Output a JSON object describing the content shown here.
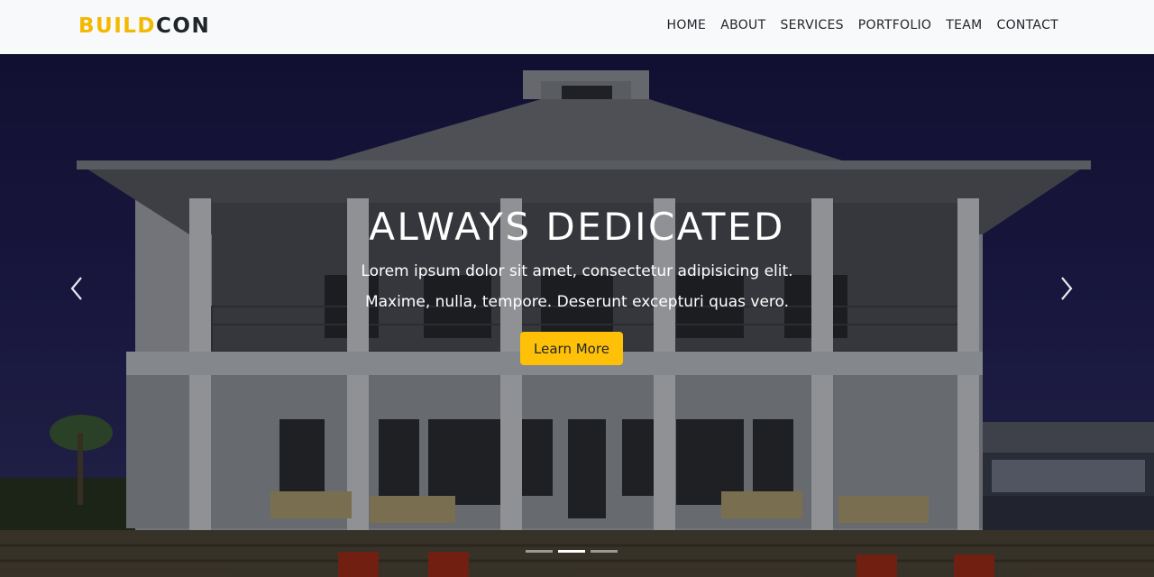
{
  "brand": {
    "part1": "BUILD",
    "part2": "CON"
  },
  "nav": {
    "items": [
      "HOME",
      "ABOUT",
      "SERVICES",
      "PORTFOLIO",
      "TEAM",
      "CONTACT"
    ]
  },
  "hero": {
    "heading": "ALWAYS DEDICATED",
    "line1": "Lorem ipsum dolor sit amet, consectetur adipisicing elit.",
    "line2": "Maxime, nulla, tempore. Deserunt excepturi quas vero.",
    "button_label": "Learn More",
    "prev_icon": "chevron-left-icon",
    "next_icon": "chevron-right-icon",
    "slides_total": 3,
    "active_slide": 2
  },
  "colors": {
    "accent": "#ffc107",
    "brand_yellow": "#f5b800",
    "nav_bg": "#f8f9fa",
    "sky": "#1b1947"
  }
}
